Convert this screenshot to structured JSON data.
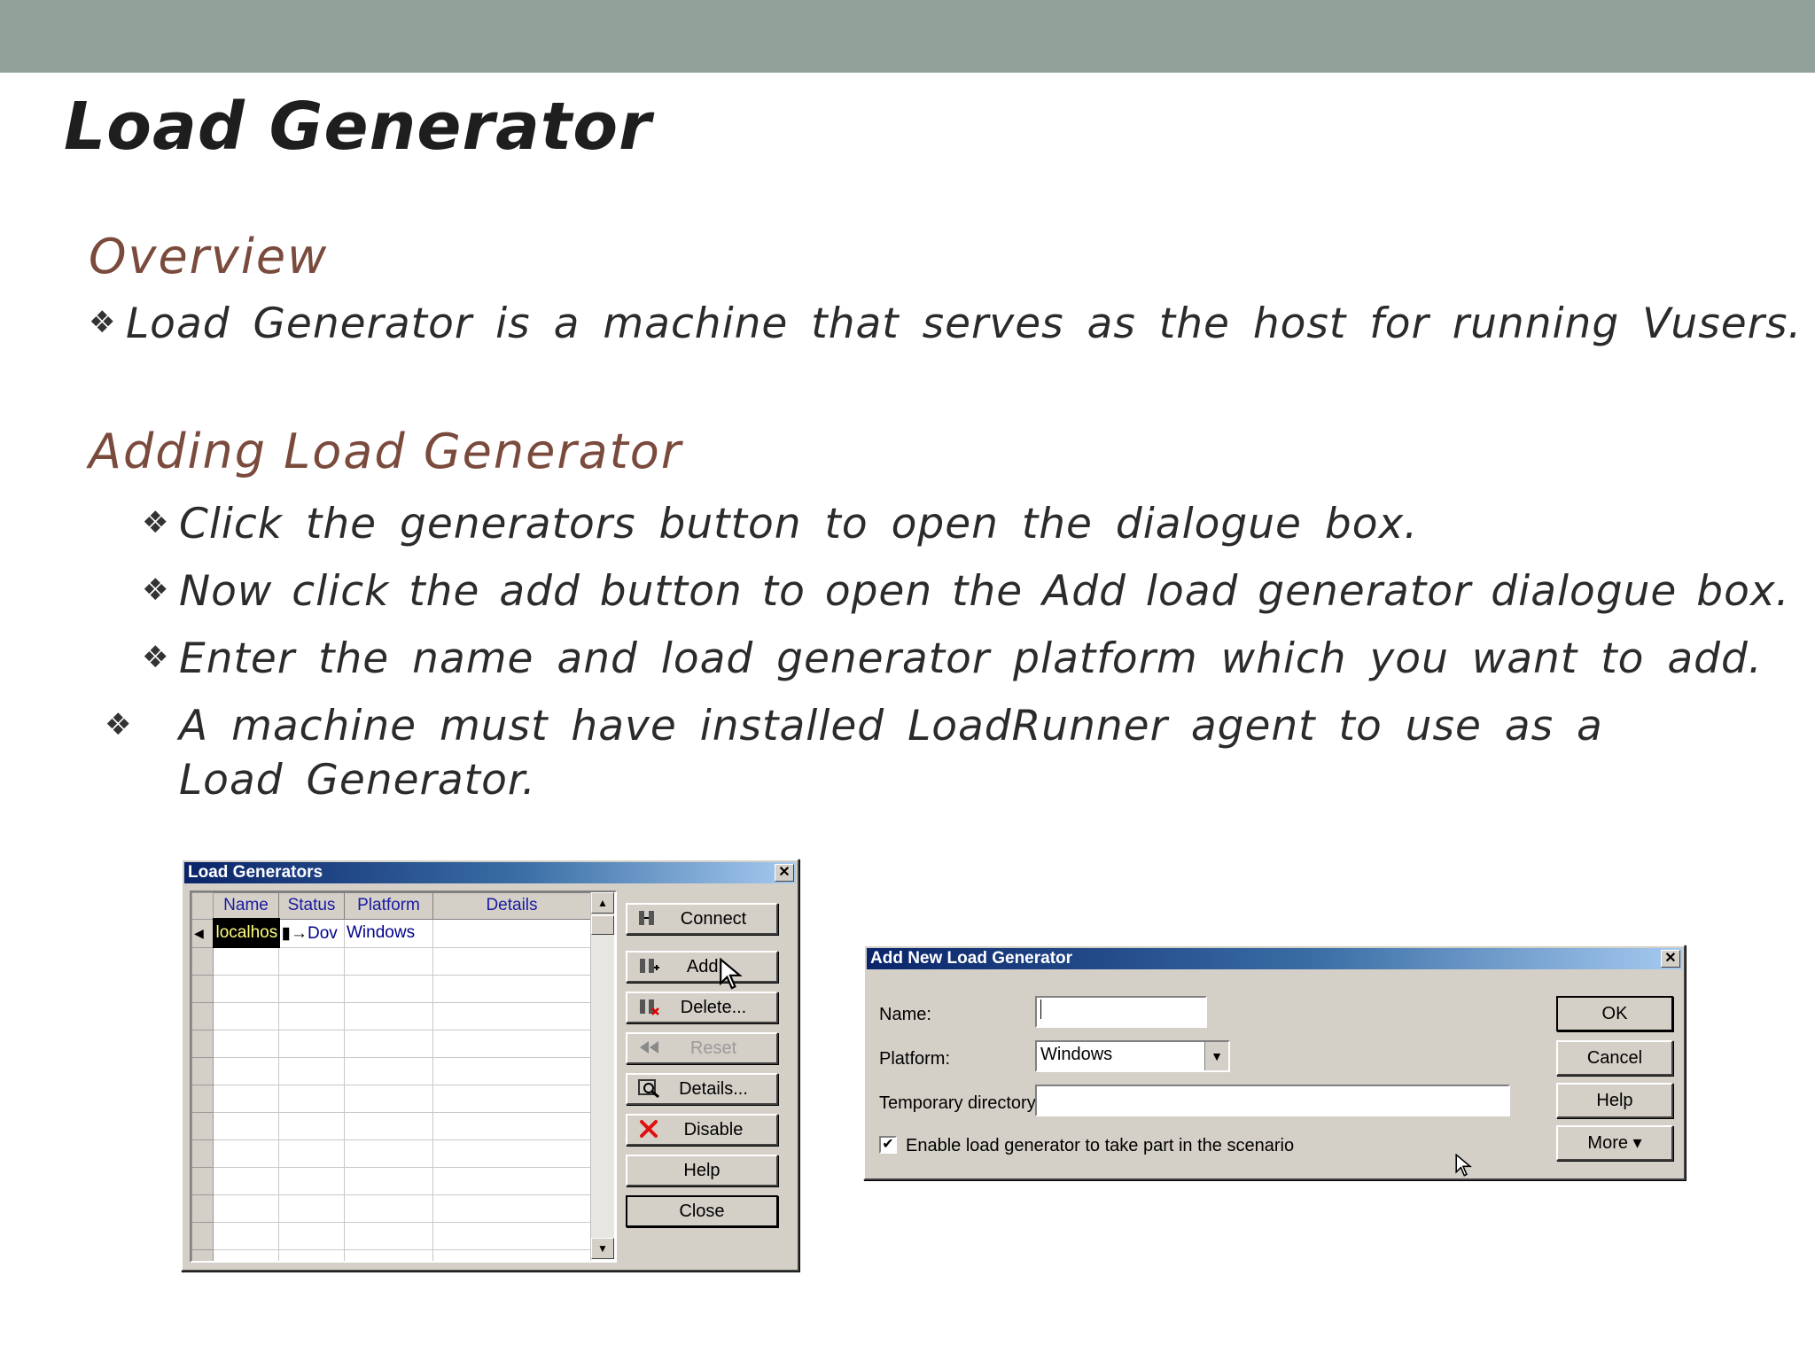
{
  "slide": {
    "title": "Load Generator",
    "overview_heading": "Overview",
    "overview_bullet": "Load Generator is a machine that serves as the host for running Vusers.",
    "adding_heading": "Adding Load Generator",
    "bullets": [
      "Click the generators button to open the dialogue box.",
      "Now click the add button to open the Add load generator dialogue box.",
      "Enter the name and load generator platform which you want to add.",
      "A machine must have installed LoadRunner agent to use as a Load Generator."
    ],
    "bullet_marker": "❖"
  },
  "load_generators_dialog": {
    "title": "Load Generators",
    "close_glyph": "✕",
    "columns": [
      "Name",
      "Status",
      "Platform",
      "Details"
    ],
    "rows": [
      {
        "name": "localhos",
        "status": "Dov",
        "platform": "Windows",
        "details": ""
      }
    ],
    "buttons": {
      "connect": "Connect",
      "add": "Add...",
      "delete": "Delete...",
      "reset": "Reset",
      "details": "Details...",
      "disable": "Disable",
      "help": "Help",
      "close": "Close"
    }
  },
  "add_dialog": {
    "title": "Add New Load Generator",
    "close_glyph": "✕",
    "name_label": "Name:",
    "name_value": "",
    "platform_label": "Platform:",
    "platform_value": "Windows",
    "tempdir_label": "Temporary directory:",
    "tempdir_value": "",
    "enable_label": "Enable load generator to take part in the scenario",
    "enable_checked": true,
    "check_glyph": "✔",
    "buttons": {
      "ok": "OK",
      "cancel": "Cancel",
      "help": "Help",
      "more": "More ▾"
    }
  },
  "colors": {
    "topbar": "#90a29a",
    "heading": "#7a4a3c",
    "titlebar_start": "#0a246a",
    "titlebar_end": "#a6caf0",
    "dialog_face": "#d4d0c8"
  }
}
